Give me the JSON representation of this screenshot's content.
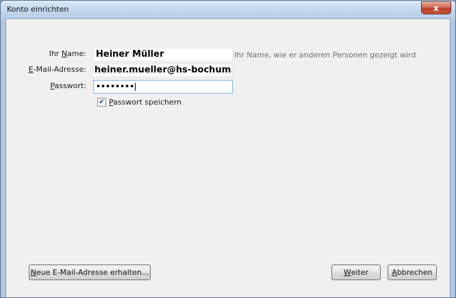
{
  "window": {
    "title": "Konto einrichten",
    "close_glyph": "x"
  },
  "form": {
    "name_label_prefix": "Ihr ",
    "name_label_accel": "N",
    "name_label_rest": "ame:",
    "name_value": "Heiner Müller",
    "name_hint": "Ihr Name, wie er anderen Personen gezeigt wird",
    "email_label_accel": "E",
    "email_label_rest": "-Mail-Adresse:",
    "email_value": "heiner.mueller@hs-bochum.de",
    "password_label_accel": "P",
    "password_label_rest": "asswort:",
    "password_value": "••••••••",
    "remember_checked": true,
    "remember_label_accel": "P",
    "remember_label_rest": "asswort speichern"
  },
  "buttons": {
    "new_email_accel": "N",
    "new_email_rest": "eue E-Mail-Adresse erhalten...",
    "next_accel": "W",
    "next_rest": "eiter",
    "cancel_accel": "A",
    "cancel_rest": "bbrechen"
  },
  "icons": {
    "checkmark": "✔"
  },
  "colors": {
    "titlebar": "#c5d8ee",
    "close_button": "#c9553d",
    "client_bg": "#f0f0f0"
  }
}
